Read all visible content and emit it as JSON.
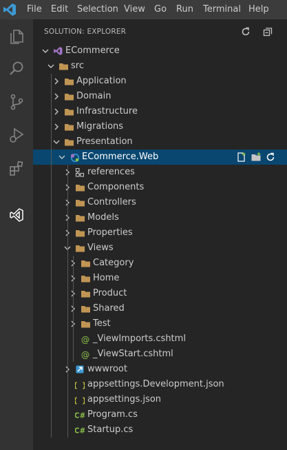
{
  "menubar": {
    "items": [
      "File",
      "Edit",
      "Selection",
      "View",
      "Go",
      "Run",
      "Terminal",
      "Help"
    ]
  },
  "activitybar": {
    "icons": [
      "explorer-icon",
      "search-icon",
      "source-control-icon",
      "run-debug-icon",
      "extensions-icon",
      "solution-explorer-icon"
    ]
  },
  "sidebar": {
    "title": "SOLUTION: EXPLORER",
    "actions": [
      "refresh-icon",
      "collapse-all-icon"
    ]
  },
  "tree": [
    {
      "label": "ECommerce",
      "type": "solution",
      "chev": "down"
    },
    {
      "label": "src",
      "type": "folder",
      "chev": "down"
    },
    {
      "label": "Application",
      "type": "folder",
      "chev": "right"
    },
    {
      "label": "Domain",
      "type": "folder",
      "chev": "right"
    },
    {
      "label": "Infrastructure",
      "type": "folder",
      "chev": "right"
    },
    {
      "label": "Migrations",
      "type": "folder",
      "chev": "right"
    },
    {
      "label": "Presentation",
      "type": "folder",
      "chev": "down"
    },
    {
      "label": "ECommerce.Web",
      "type": "project",
      "chev": "down",
      "selected": true
    },
    {
      "label": "references",
      "type": "references",
      "chev": "right"
    },
    {
      "label": "Components",
      "type": "folder",
      "chev": "right"
    },
    {
      "label": "Controllers",
      "type": "folder",
      "chev": "right"
    },
    {
      "label": "Models",
      "type": "folder",
      "chev": "right"
    },
    {
      "label": "Properties",
      "type": "folder",
      "chev": "right"
    },
    {
      "label": "Views",
      "type": "folder",
      "chev": "down"
    },
    {
      "label": "Category",
      "type": "folder",
      "chev": "right"
    },
    {
      "label": "Home",
      "type": "folder",
      "chev": "right"
    },
    {
      "label": "Product",
      "type": "folder",
      "chev": "right"
    },
    {
      "label": "Shared",
      "type": "folder",
      "chev": "right"
    },
    {
      "label": "Test",
      "type": "folder",
      "chev": "right"
    },
    {
      "label": "_ViewImports.cshtml",
      "type": "razor",
      "chev": "none"
    },
    {
      "label": "_ViewStart.cshtml",
      "type": "razor",
      "chev": "none"
    },
    {
      "label": "wwwroot",
      "type": "wwwroot",
      "chev": "right"
    },
    {
      "label": "appsettings.Development.json",
      "type": "json",
      "chev": "none"
    },
    {
      "label": "appsettings.json",
      "type": "json",
      "chev": "none"
    },
    {
      "label": "Program.cs",
      "type": "csharp",
      "chev": "none"
    },
    {
      "label": "Startup.cs",
      "type": "csharp",
      "chev": "none"
    }
  ],
  "selected_row_actions": [
    "new-file-icon",
    "new-folder-icon",
    "refresh-icon"
  ],
  "colors": {
    "menubar": "#3c3c3c",
    "activitybar": "#333333",
    "sidebar": "#252526",
    "selection": "#094771",
    "folder": "#c09553",
    "json": "#cbcb41",
    "csharp": "#8dc149",
    "razor": "#8dc149",
    "vs-blue": "#3c99d4"
  }
}
